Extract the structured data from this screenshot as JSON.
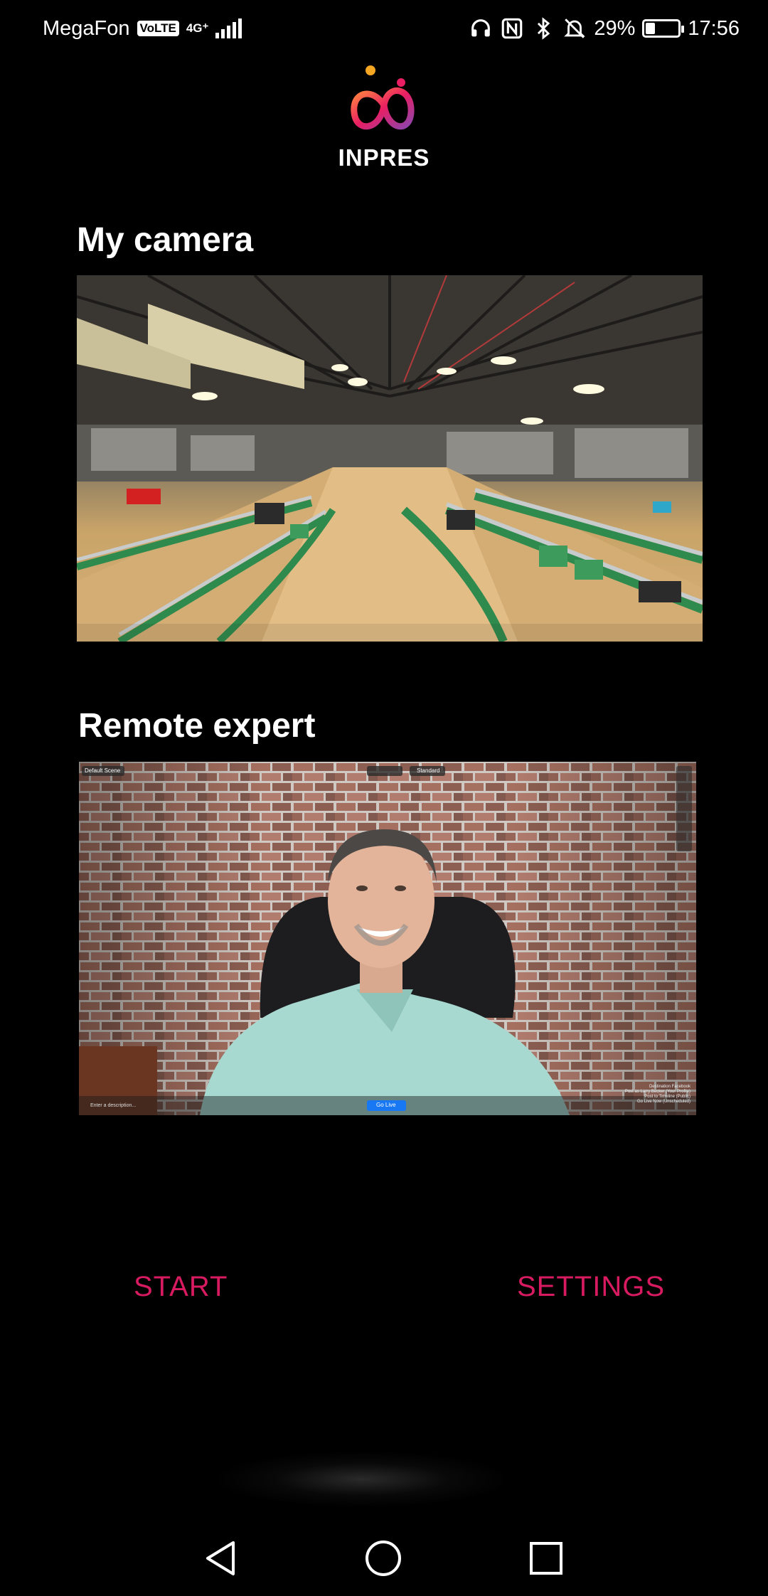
{
  "status_bar": {
    "carrier": "MegaFon",
    "volte": "VoLTE",
    "network": "4G⁺",
    "battery_percent": "29%",
    "battery_level": 0.29,
    "time": "17:56",
    "icons": [
      "headphones-icon",
      "nfc-icon",
      "bluetooth-icon",
      "bell-off-icon",
      "battery-icon"
    ]
  },
  "app": {
    "logo_text": "INPRES",
    "accent_color": "#d81b60"
  },
  "my_camera": {
    "title": "My camera"
  },
  "remote_expert": {
    "title": "Remote expert",
    "overlay": {
      "scene_label": "Default Scene",
      "quality_label": "Standard",
      "description_placeholder": "Enter a description...",
      "go_live_label": "Go Live",
      "stats": [
        "Destination Facebook",
        "Post as Larry Becker (Your Profile)",
        "Post to Timeline (Public)",
        "Go Live Now (Unscheduled)"
      ]
    }
  },
  "actions": {
    "start_label": "START",
    "settings_label": "SETTINGS"
  },
  "nav": {
    "icons": [
      "back-icon",
      "home-icon",
      "recents-icon"
    ]
  }
}
